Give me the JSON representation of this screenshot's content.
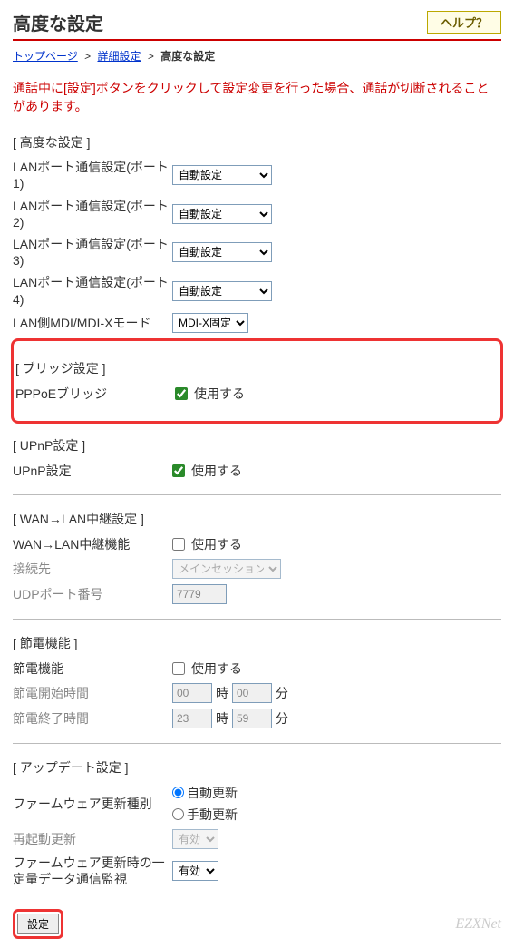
{
  "header": {
    "title": "高度な設定",
    "help": "ヘルプ？"
  },
  "breadcrumb": {
    "top": "トップページ",
    "mid": "詳細設定",
    "current": "高度な設定",
    "sep": ">"
  },
  "warning": "通話中に[設定]ボタンをクリックして設定変更を行った場合、通話が切断されることがあります。",
  "advanced": {
    "section": "[ 高度な設定 ]",
    "port1_label": "LANポート通信設定(ポート1)",
    "port2_label": "LANポート通信設定(ポート2)",
    "port3_label": "LANポート通信設定(ポート3)",
    "port4_label": "LANポート通信設定(ポート4)",
    "port_value": "自動設定",
    "mdi_label": "LAN側MDI/MDI-Xモード",
    "mdi_value": "MDI-X固定"
  },
  "bridge": {
    "section": "[ ブリッジ設定 ]",
    "pppoe_label": "PPPoEブリッジ",
    "use_label": "使用する",
    "checked": true
  },
  "upnp": {
    "section": "[ UPnP設定 ]",
    "label": "UPnP設定",
    "use_label": "使用する",
    "checked": true
  },
  "relay": {
    "section": "[ WAN→LAN中継設定 ]",
    "func_label": "WAN→LAN中継機能",
    "use_label": "使用する",
    "checked": false,
    "dest_label": "接続先",
    "dest_value": "メインセッション",
    "udp_label": "UDPポート番号",
    "udp_value": "7779"
  },
  "power": {
    "section": "[ 節電機能 ]",
    "func_label": "節電機能",
    "use_label": "使用する",
    "checked": false,
    "start_label": "節電開始時間",
    "start_hh": "00",
    "start_mm": "00",
    "end_label": "節電終了時間",
    "end_hh": "23",
    "end_mm": "59",
    "hh_unit": "時",
    "mm_unit": "分"
  },
  "update": {
    "section": "[ アップデート設定 ]",
    "type_label": "ファームウェア更新種別",
    "auto_label": "自動更新",
    "manual_label": "手動更新",
    "reboot_label": "再起動更新",
    "reboot_value": "有効",
    "monitor_label": "ファームウェア更新時の一定量データ通信監視",
    "monitor_value": "有効"
  },
  "submit": "設定",
  "watermark": "EZXNet"
}
